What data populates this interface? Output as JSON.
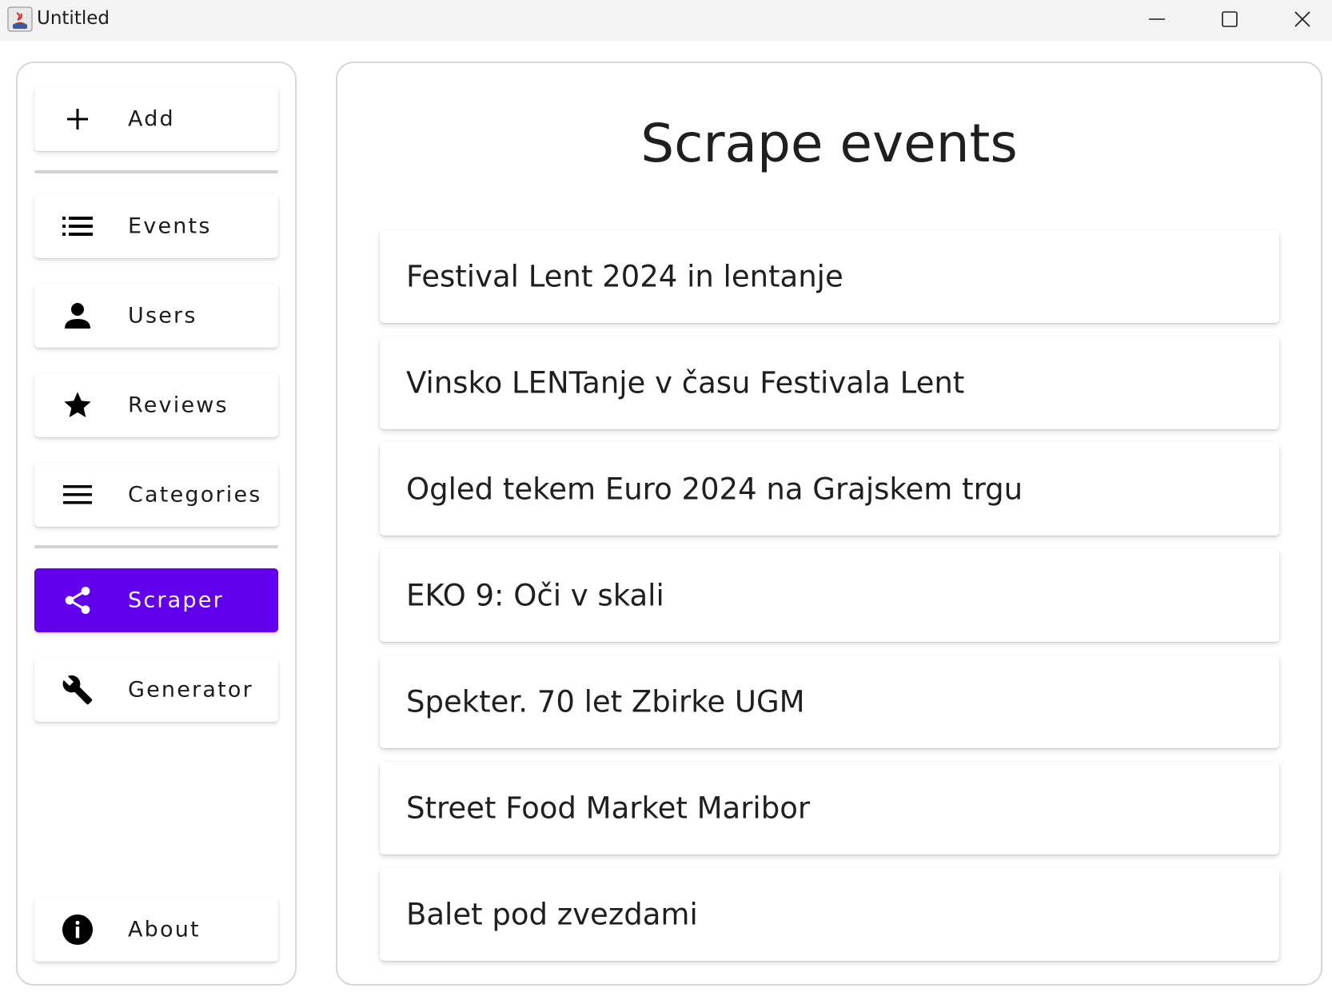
{
  "window": {
    "title": "Untitled",
    "controls": [
      "minimize-icon",
      "maximize-icon",
      "close-icon"
    ]
  },
  "sidebar": {
    "items": [
      {
        "label": "Add",
        "icon": "plus-icon",
        "active": false
      },
      {
        "label": "Events",
        "icon": "list-icon",
        "active": false
      },
      {
        "label": "Users",
        "icon": "person-icon",
        "active": false
      },
      {
        "label": "Reviews",
        "icon": "star-icon",
        "active": false
      },
      {
        "label": "Categories",
        "icon": "menu-icon",
        "active": false
      },
      {
        "label": "Scraper",
        "icon": "share-icon",
        "active": true
      },
      {
        "label": "Generator",
        "icon": "wrench-icon",
        "active": false
      },
      {
        "label": "About",
        "icon": "info-icon",
        "active": false
      }
    ]
  },
  "main": {
    "title": "Scrape events",
    "events": [
      "Festival Lent 2024 in lentanje",
      "Vinsko LENTanje v času Festivala Lent",
      "Ogled tekem Euro 2024 na Grajskem trgu",
      "EKO 9: Oči v skali",
      "Spekter. 70 let Zbirke UGM",
      "Street Food Market Maribor",
      "Balet pod zvezdami"
    ]
  },
  "colors": {
    "accent": "#6200ee",
    "titlebar": "#f3f3f3",
    "border": "#d7d7d7"
  }
}
